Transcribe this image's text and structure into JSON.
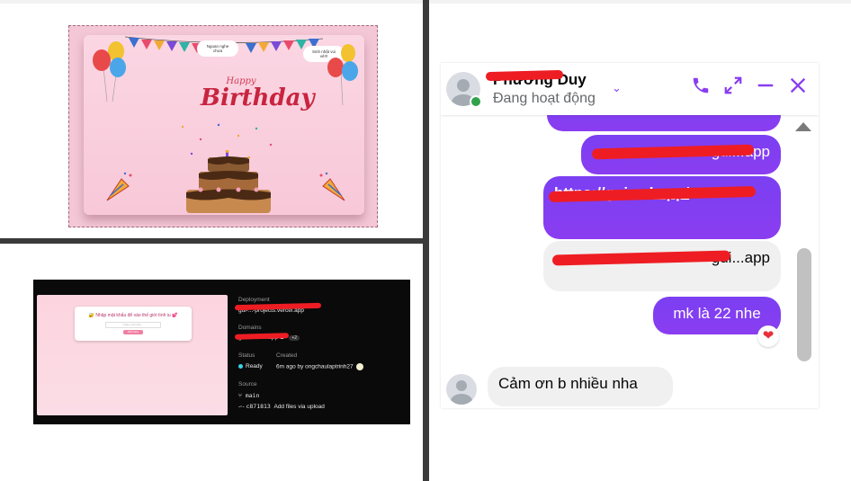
{
  "birthday_card": {
    "cloud_left": "Ngoan nghe chưa",
    "cloud_right": "Sinh nhật vui vẻ!!!",
    "title_happy": "Happy",
    "title_birthday": "Birthday"
  },
  "vercel": {
    "dialog_title": "🔐 Nhập mật khẩu để vào thế giới tình iu 💕",
    "dialog_placeholder": "Nhập mật khẩu...",
    "dialog_button": "Mở khóa",
    "deployment_label": "Deployment",
    "deployment_value": "gui-...-projects.vercel.app",
    "domains_label": "Domains",
    "domains_value": "gui...vercel.app",
    "domains_extra": "+2",
    "status_label": "Status",
    "status_value": "Ready",
    "created_label": "Created",
    "created_value": "6m ago by ongchaulaptrinh27",
    "source_label": "Source",
    "branch": "main",
    "commit_hash": "c871813",
    "commit_message": "Add files via upload"
  },
  "chat": {
    "contact_name": "Phương Duy",
    "status": "Đang hoạt động",
    "messages": [
      {
        "text": "gui...app",
        "side": "right"
      },
      {
        "text": "https://gui...el.app/",
        "side": "right"
      },
      {
        "text": "gui...app",
        "side": "right"
      },
      {
        "text": "mk là 22 nhe",
        "side": "right",
        "reaction": "❤"
      },
      {
        "text": "Cảm ơn b nhiều nha",
        "side": "left"
      }
    ],
    "colors": {
      "accent": "#8a3df0",
      "online": "#31a24c",
      "redaction": "#ee1d23"
    }
  }
}
